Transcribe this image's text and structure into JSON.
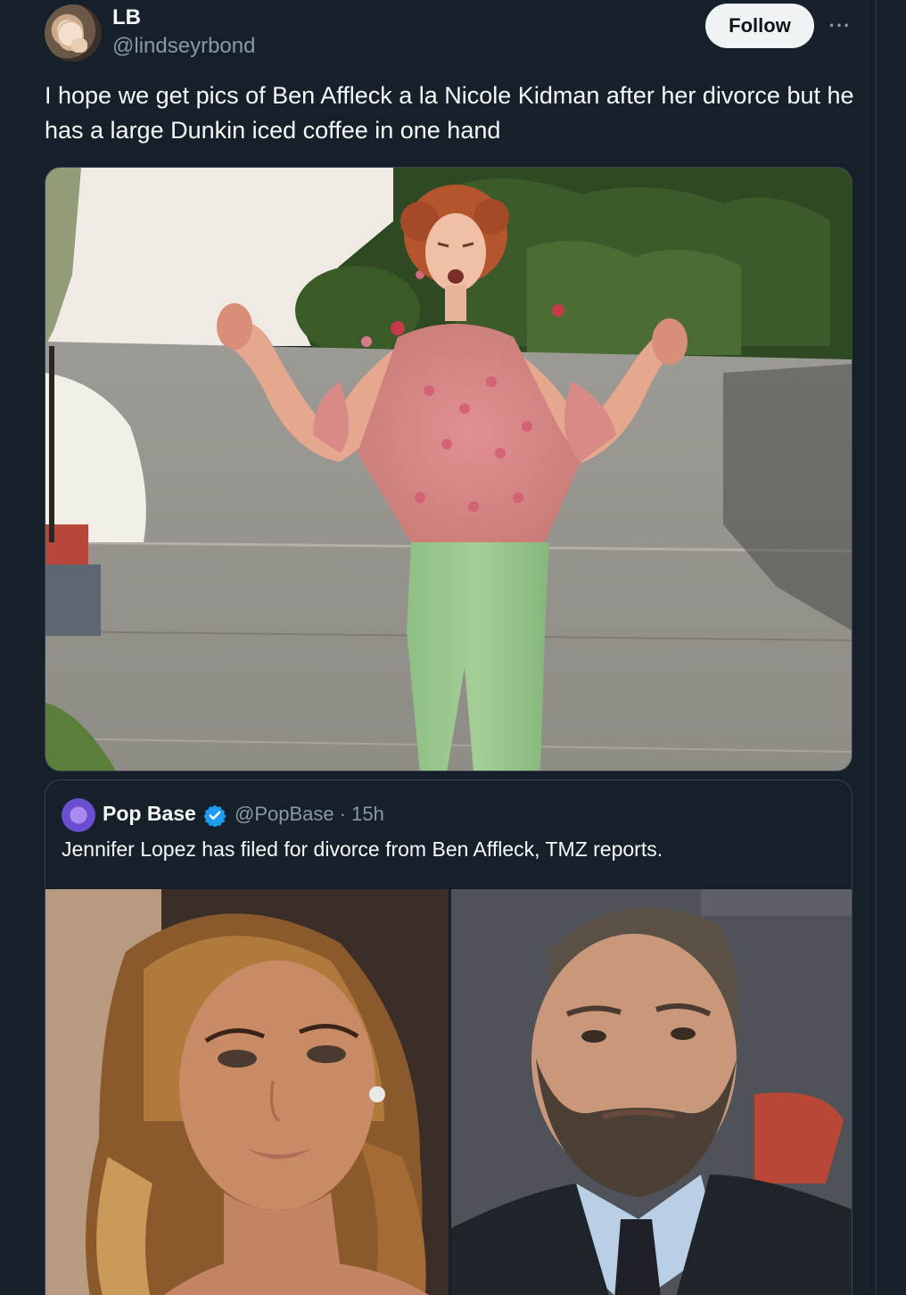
{
  "tweet": {
    "author_name": "LB",
    "author_handle": "@lindseyrbond",
    "follow_label": "Follow",
    "more_icon": "···",
    "text": "I hope we get pics of Ben Affleck a la Nicole Kidman after her divorce but he has a large Dunkin iced coffee in one hand"
  },
  "quote": {
    "author_name": "Pop Base",
    "author_handle": "@PopBase · 15h",
    "text": "Jennifer Lopez has filed for divorce from Ben Affleck, TMZ reports.",
    "verified_color": "#1d9bf0"
  },
  "colors": {
    "background": "#15202b",
    "text_primary": "#f7f9f9",
    "text_secondary": "#8b98a5",
    "border": "#38444d",
    "follow_bg": "#eff3f4"
  }
}
